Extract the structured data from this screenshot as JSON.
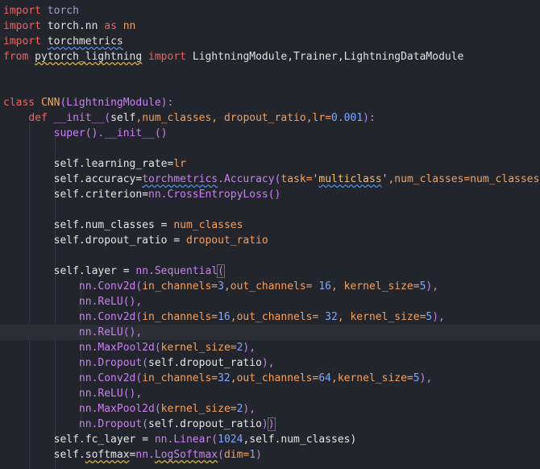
{
  "editor": {
    "lines": [
      [
        {
          "t": "import",
          "c": "kw"
        },
        {
          "t": " torch",
          "c": "dim"
        }
      ],
      [
        {
          "t": "import",
          "c": "kw"
        },
        {
          "t": " torch.nn ",
          "c": "mod"
        },
        {
          "t": "as",
          "c": "kw"
        },
        {
          "t": " nn",
          "c": "param"
        }
      ],
      [
        {
          "t": "import",
          "c": "kw"
        },
        {
          "t": " ",
          "c": "mod"
        },
        {
          "t": "torchmetrics",
          "c": "mod",
          "u": "blue"
        }
      ],
      [
        {
          "t": "from",
          "c": "kw"
        },
        {
          "t": " ",
          "c": "mod"
        },
        {
          "t": "pytorch_lightning",
          "c": "mod",
          "u": "yellow"
        },
        {
          "t": " ",
          "c": "mod"
        },
        {
          "t": "import",
          "c": "kw"
        },
        {
          "t": " LightningModule,Trainer,LightningDataModule",
          "c": "mod"
        }
      ],
      [],
      [],
      [
        {
          "t": "class",
          "c": "kw"
        },
        {
          "t": " CNN",
          "c": "cls"
        },
        {
          "t": "(LightningModule):",
          "c": "fn"
        }
      ],
      [
        {
          "t": "    ",
          "c": "mod"
        },
        {
          "t": "def",
          "c": "kw"
        },
        {
          "t": " __init__",
          "c": "fn"
        },
        {
          "t": "(",
          "c": "fn"
        },
        {
          "t": "self",
          "c": "self"
        },
        {
          "t": ",num_classes, dropout_ratio,lr=",
          "c": "param"
        },
        {
          "t": "0.001",
          "c": "num"
        },
        {
          "t": "):",
          "c": "fn"
        }
      ],
      [
        {
          "t": "        ",
          "c": "mod"
        },
        {
          "t": "super",
          "c": "fn"
        },
        {
          "t": "().",
          "c": "fn"
        },
        {
          "t": "__init__",
          "c": "fn"
        },
        {
          "t": "()",
          "c": "fn"
        }
      ],
      [],
      [
        {
          "t": "        self.learning_rate",
          "c": "self"
        },
        {
          "t": "=",
          "c": "op"
        },
        {
          "t": "lr",
          "c": "param"
        }
      ],
      [
        {
          "t": "        self.accuracy",
          "c": "self"
        },
        {
          "t": "=",
          "c": "op"
        },
        {
          "t": "torchmetrics",
          "c": "fn",
          "u": "blue"
        },
        {
          "t": ".Accuracy(",
          "c": "fn"
        },
        {
          "t": "task=",
          "c": "param"
        },
        {
          "t": "'",
          "c": "str"
        },
        {
          "t": "multiclass",
          "c": "str",
          "u": "blue"
        },
        {
          "t": "'",
          "c": "str"
        },
        {
          "t": ",num_classes=num_classes)",
          "c": "param"
        }
      ],
      [
        {
          "t": "        self.criterion",
          "c": "self"
        },
        {
          "t": "=",
          "c": "op"
        },
        {
          "t": "nn.CrossEntropyLoss()",
          "c": "fn"
        }
      ],
      [],
      [
        {
          "t": "        self.num_classes ",
          "c": "self"
        },
        {
          "t": "= ",
          "c": "op"
        },
        {
          "t": "num_classes",
          "c": "param"
        }
      ],
      [
        {
          "t": "        self.dropout_ratio ",
          "c": "self"
        },
        {
          "t": "= ",
          "c": "op"
        },
        {
          "t": "dropout_ratio",
          "c": "param"
        }
      ],
      [],
      [
        {
          "t": "        self.layer ",
          "c": "self"
        },
        {
          "t": "= ",
          "c": "op"
        },
        {
          "t": "nn.Sequential",
          "c": "fn"
        },
        {
          "t": "(",
          "c": "fn",
          "h": true
        }
      ],
      [
        {
          "t": "            nn.Conv2d(",
          "c": "fn"
        },
        {
          "t": "in_channels=",
          "c": "param"
        },
        {
          "t": "3",
          "c": "num"
        },
        {
          "t": ",out_channels= ",
          "c": "param"
        },
        {
          "t": "16",
          "c": "num"
        },
        {
          "t": ", kernel_size=",
          "c": "param"
        },
        {
          "t": "5",
          "c": "num"
        },
        {
          "t": "),",
          "c": "fn"
        }
      ],
      [
        {
          "t": "            nn.ReLU(),",
          "c": "fn"
        }
      ],
      [
        {
          "t": "            nn.Conv2d(",
          "c": "fn"
        },
        {
          "t": "in_channels=",
          "c": "param"
        },
        {
          "t": "16",
          "c": "num"
        },
        {
          "t": ",out_channels= ",
          "c": "param"
        },
        {
          "t": "32",
          "c": "num"
        },
        {
          "t": ", kernel_size=",
          "c": "param"
        },
        {
          "t": "5",
          "c": "num"
        },
        {
          "t": "),",
          "c": "fn"
        }
      ],
      [
        {
          "t": "            nn.ReLU(),",
          "c": "fn"
        }
      ],
      [
        {
          "t": "            nn.MaxPool2d(",
          "c": "fn"
        },
        {
          "t": "kernel_size=",
          "c": "param"
        },
        {
          "t": "2",
          "c": "num"
        },
        {
          "t": "),",
          "c": "fn"
        }
      ],
      [
        {
          "t": "            nn.Dropout(",
          "c": "fn"
        },
        {
          "t": "self.dropout_ratio",
          "c": "self"
        },
        {
          "t": "),",
          "c": "fn"
        }
      ],
      [
        {
          "t": "            nn.Conv2d(",
          "c": "fn"
        },
        {
          "t": "in_channels=",
          "c": "param"
        },
        {
          "t": "32",
          "c": "num"
        },
        {
          "t": ",out_channels=",
          "c": "param"
        },
        {
          "t": "64",
          "c": "num"
        },
        {
          "t": ",kernel_size=",
          "c": "param"
        },
        {
          "t": "5",
          "c": "num"
        },
        {
          "t": "),",
          "c": "fn"
        }
      ],
      [
        {
          "t": "            nn.ReLU(),",
          "c": "fn"
        }
      ],
      [
        {
          "t": "            nn.MaxPool2d(",
          "c": "fn"
        },
        {
          "t": "kernel_size=",
          "c": "param"
        },
        {
          "t": "2",
          "c": "num"
        },
        {
          "t": "),",
          "c": "fn"
        }
      ],
      [
        {
          "t": "            nn.Dropout(",
          "c": "fn"
        },
        {
          "t": "self.dropout_ratio",
          "c": "self"
        },
        {
          "t": ")",
          "c": "fn"
        },
        {
          "t": ")",
          "c": "fn",
          "h": true
        }
      ],
      [
        {
          "t": "        self.fc_layer ",
          "c": "self"
        },
        {
          "t": "= ",
          "c": "op"
        },
        {
          "t": "nn.Linear(",
          "c": "fn"
        },
        {
          "t": "1024",
          "c": "num"
        },
        {
          "t": ",self.num_classes)",
          "c": "self"
        }
      ],
      [
        {
          "t": "        self.",
          "c": "self"
        },
        {
          "t": "softmax",
          "c": "self",
          "u": "yellow"
        },
        {
          "t": "=",
          "c": "op"
        },
        {
          "t": "nn.",
          "c": "fn"
        },
        {
          "t": "LogSoftmax",
          "c": "fn",
          "u": "yellow"
        },
        {
          "t": "(",
          "c": "fn"
        },
        {
          "t": "dim=",
          "c": "param"
        },
        {
          "t": "1",
          "c": "num"
        },
        {
          "t": ")",
          "c": "fn"
        }
      ]
    ],
    "current_line": 21,
    "colors": {
      "background": "#23252c",
      "current_line": "#2c2f36",
      "keyword": "#f2615c",
      "function": "#c980f0",
      "parameter": "#f5a05c",
      "number": "#7fa8ff",
      "string": "#f2c16a"
    }
  }
}
